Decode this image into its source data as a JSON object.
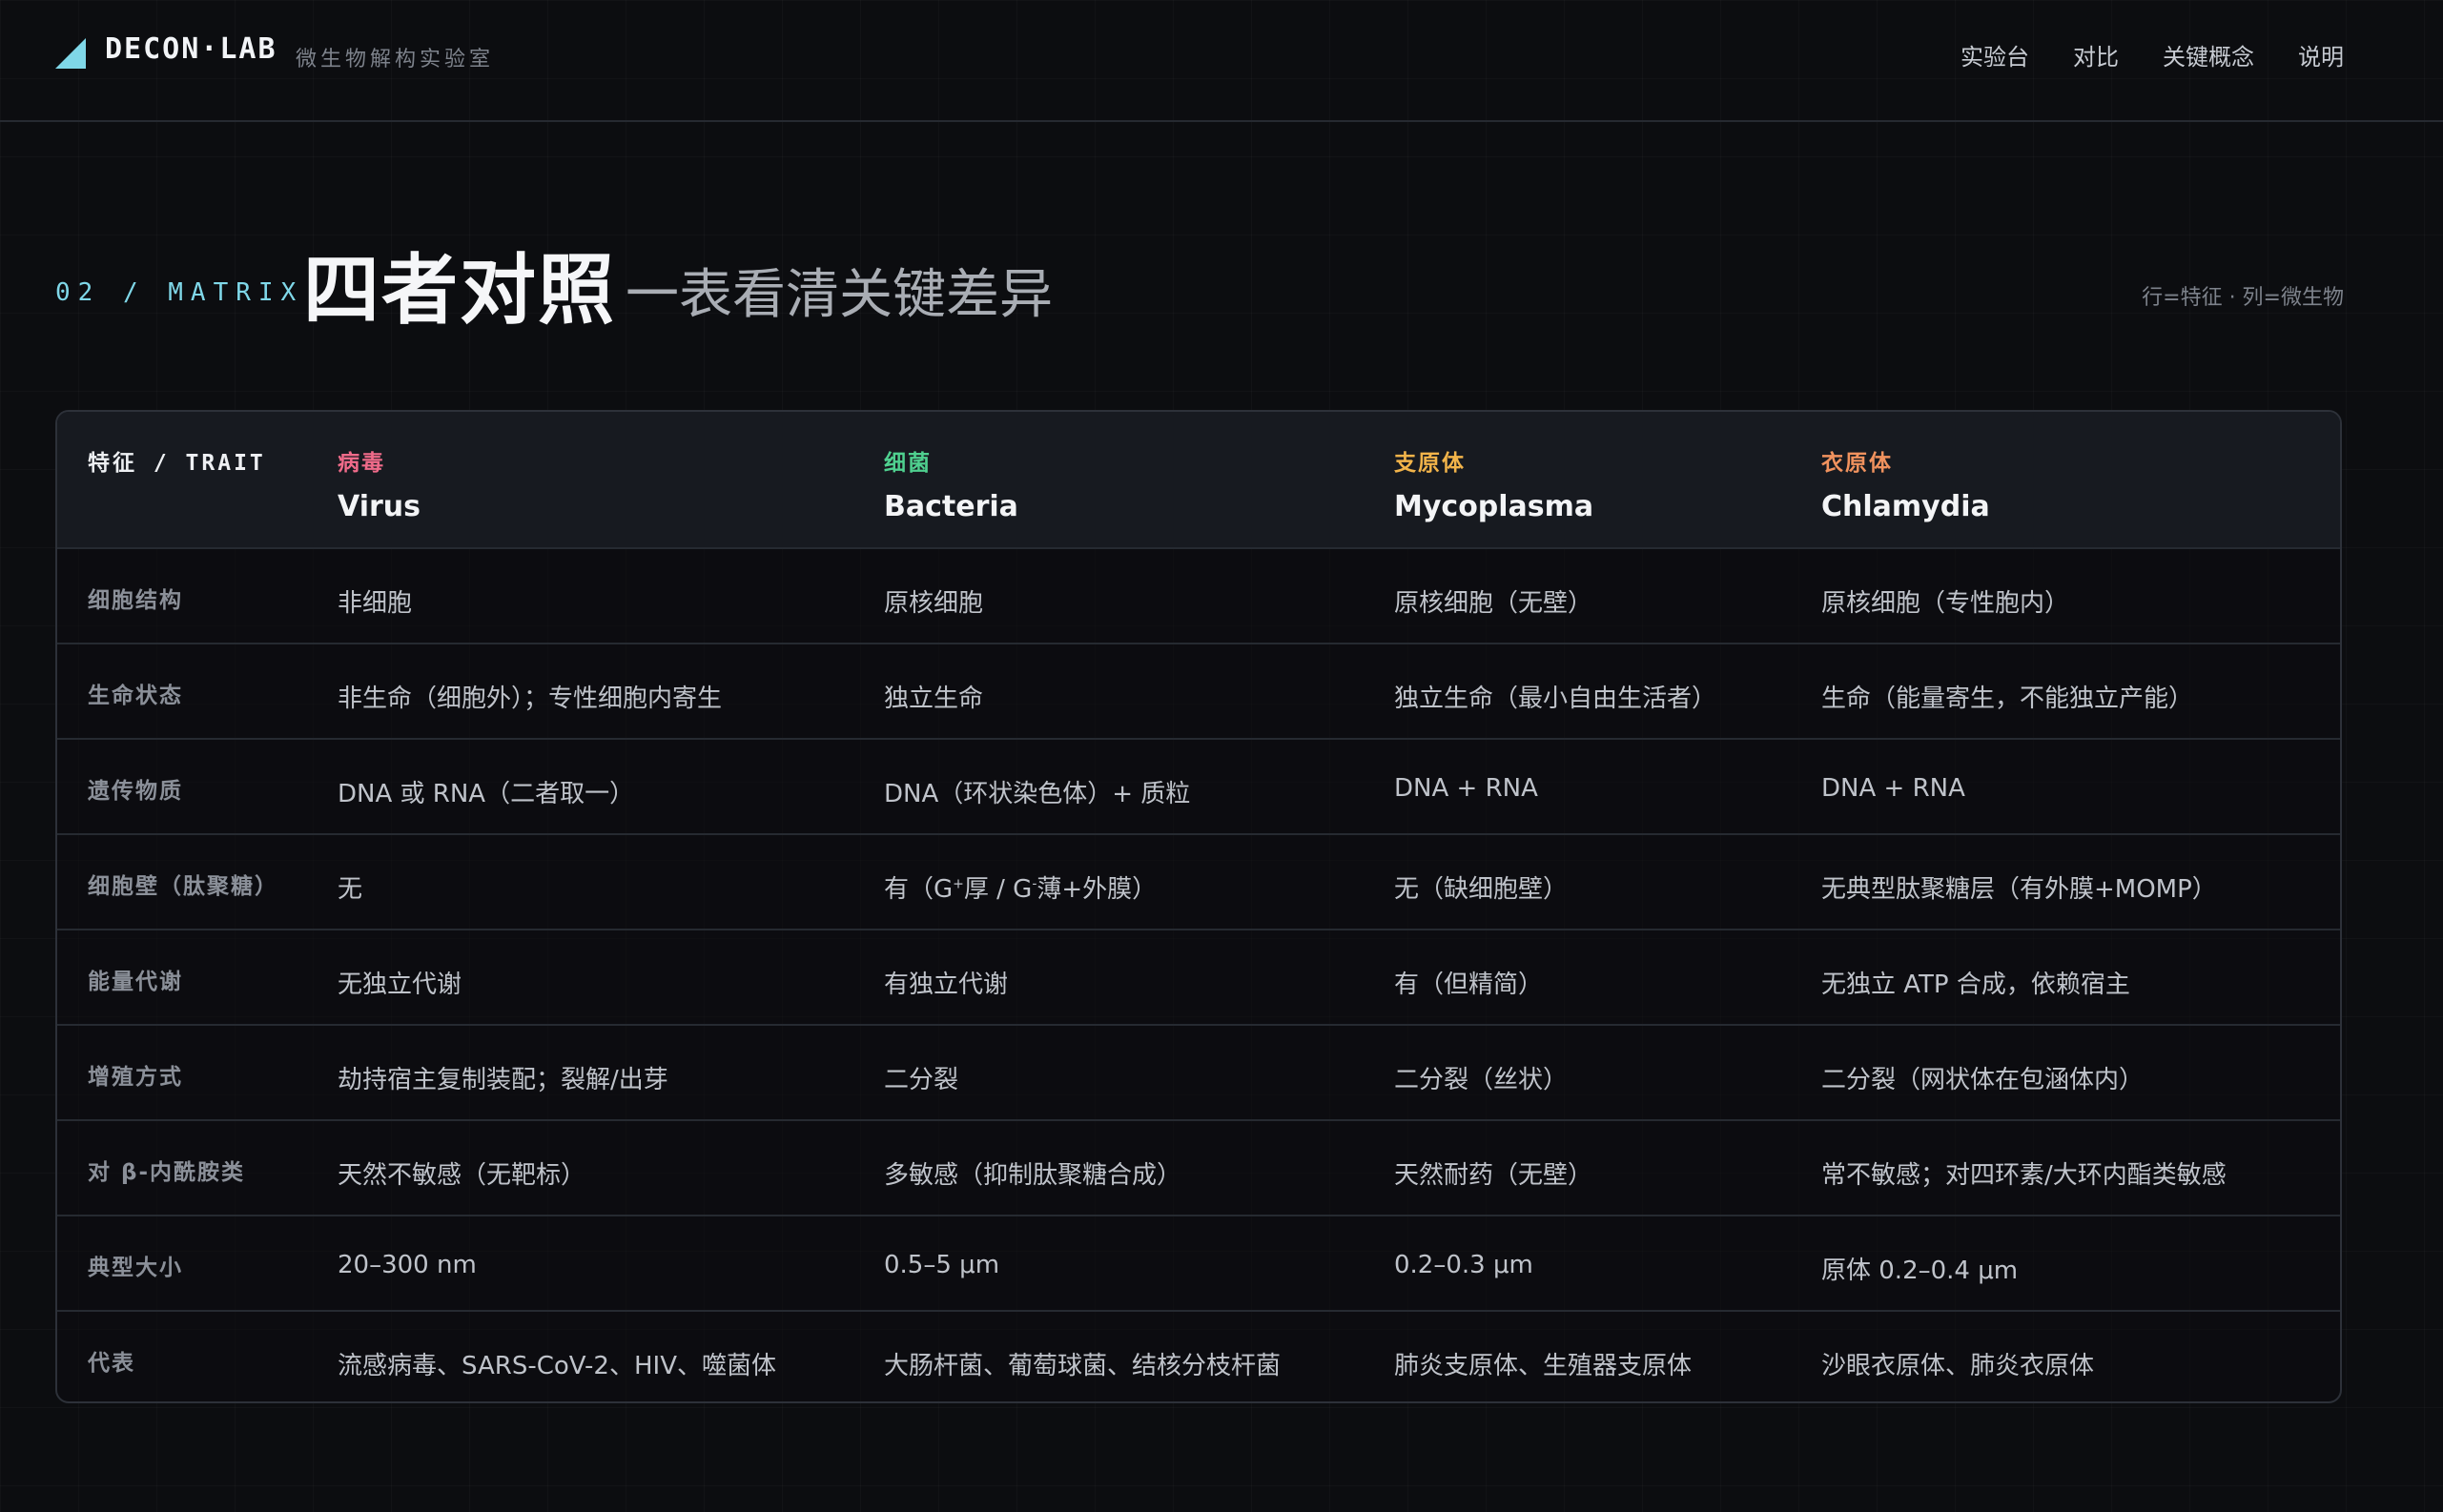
{
  "header": {
    "brand": "DECON·LAB",
    "brand_sub": "微生物解构实验室",
    "accent_color": "#7fd7e8",
    "nav": [
      "实验台",
      "对比",
      "关键概念",
      "说明"
    ]
  },
  "section": {
    "index": "02 / MATRIX",
    "title": "四者对照",
    "subtitle": "一表看清关键差异",
    "hint": "行=特征 · 列=微生物"
  },
  "matrix": {
    "trait_header": "特征 / TRAIT",
    "organisms": [
      {
        "cn": "病毒",
        "en": "Virus",
        "color": "#f06b8a"
      },
      {
        "cn": "细菌",
        "en": "Bacteria",
        "color": "#4fd08f"
      },
      {
        "cn": "支原体",
        "en": "Mycoplasma",
        "color": "#f2b44a"
      },
      {
        "cn": "衣原体",
        "en": "Chlamydia",
        "color": "#f0925e"
      }
    ],
    "rows": [
      {
        "trait": "细胞结构",
        "values": [
          "非细胞",
          "原核细胞",
          "原核细胞（无壁）",
          "原核细胞（专性胞内）"
        ]
      },
      {
        "trait": "生命状态",
        "values": [
          "非生命（细胞外）；专性细胞内寄生",
          "独立生命",
          "独立生命（最小自由生活者）",
          "生命（能量寄生，不能独立产能）"
        ]
      },
      {
        "trait": "遗传物质",
        "values": [
          "DNA 或 RNA（二者取一）",
          "DNA（环状染色体）+ 质粒",
          "DNA + RNA",
          "DNA + RNA"
        ]
      },
      {
        "trait": "细胞壁（肽聚糖）",
        "values": [
          "无",
          "有（G+厚 / G-薄+外膜）",
          "无（缺细胞壁）",
          "无典型肽聚糖层（有外膜+MOMP）"
        ]
      },
      {
        "trait": "能量代谢",
        "values": [
          "无独立代谢",
          "有独立代谢",
          "有（但精简）",
          "无独立 ATP 合成，依赖宿主"
        ]
      },
      {
        "trait": "增殖方式",
        "values": [
          "劫持宿主复制装配；裂解/出芽",
          "二分裂",
          "二分裂（丝状）",
          "二分裂（网状体在包涵体内）"
        ]
      },
      {
        "trait": "对 β-内酰胺类",
        "values": [
          "天然不敏感（无靶标）",
          "多敏感（抑制肽聚糖合成）",
          "天然耐药（无壁）",
          "常不敏感；对四环素/大环内酯类敏感"
        ]
      },
      {
        "trait": "典型大小",
        "values": [
          "20–300 nm",
          "0.5–5 μm",
          "0.2–0.3 μm",
          "原体 0.2–0.4 μm"
        ]
      },
      {
        "trait": "代表",
        "values": [
          "流感病毒、SARS-CoV-2、HIV、噬菌体",
          "大肠杆菌、葡萄球菌、结核分枝杆菌",
          "肺炎支原体、生殖器支原体",
          "沙眼衣原体、肺炎衣原体"
        ]
      }
    ]
  }
}
